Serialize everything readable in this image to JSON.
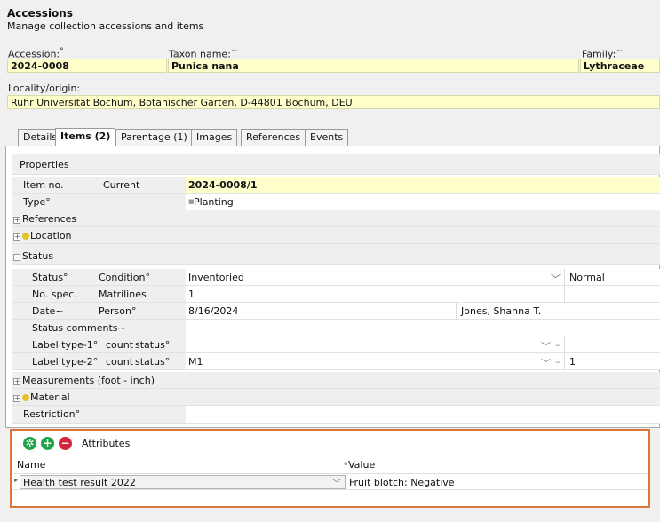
{
  "header": {
    "title": "Accessions",
    "subtitle": "Manage collection accessions and items"
  },
  "fields": {
    "accession_label": "Accession:",
    "accession_value": "2024-0008",
    "taxon_label": "Taxon name:",
    "taxon_value": "Punica nana",
    "family_label": "Family:",
    "family_value": "Lythraceae",
    "locality_label": "Locality/origin:",
    "locality_value": "Ruhr Universität Bochum, Botanischer Garten, D-44801 Bochum, DEU",
    "required_mark": "°",
    "tilde_mark": "~"
  },
  "tabs": [
    {
      "label": "Details"
    },
    {
      "label": "Items (2)"
    },
    {
      "label": "Parentage (1)"
    },
    {
      "label": "Images"
    },
    {
      "label": "References"
    },
    {
      "label": "Events"
    }
  ],
  "properties": {
    "title": "Properties",
    "item_no_label": "Item no.",
    "current_label": "Current",
    "item_no_value": "2024-0008/1",
    "type_label": "Type°",
    "type_value": "Planting",
    "references_label": "References",
    "location_label": "Location",
    "status_group_label": "Status",
    "status_label": "Status°",
    "condition_label": "Condition°",
    "status_value": "Inventoried",
    "condition_value": "Normal",
    "no_spec_label": "No. spec.",
    "matrilines_label": "Matrilines",
    "no_spec_value": "1",
    "date_label": "Date~",
    "person_label": "Person°",
    "date_value": "8/16/2024",
    "person_value": "Jones, Shanna T.",
    "status_comments_label": "Status comments~",
    "label1_a": "Label type-1°",
    "label1_b": "count",
    "label1_c": "status°",
    "label1_dash": "–",
    "label2_a": "Label type-2°",
    "label2_b": "count",
    "label2_c": "status°",
    "label2_value": "M1",
    "label2_dash": "–",
    "label2_count": "1",
    "measurements_label": "Measurements (foot - inch)",
    "material_label": "Material",
    "restriction_label": "Restriction°"
  },
  "attributes": {
    "title": "Attributes",
    "col_name": "Name",
    "col_value": "Value",
    "row_name": "Health test result 2022",
    "row_value": "Fruit blotch: Negative"
  },
  "colors": {
    "highlight_border": "#d9773c",
    "field_yellow": "#ffffcc",
    "add_green": "#1fa34a",
    "remove_red": "#d2263c",
    "location_dot": "#e5c12a"
  }
}
